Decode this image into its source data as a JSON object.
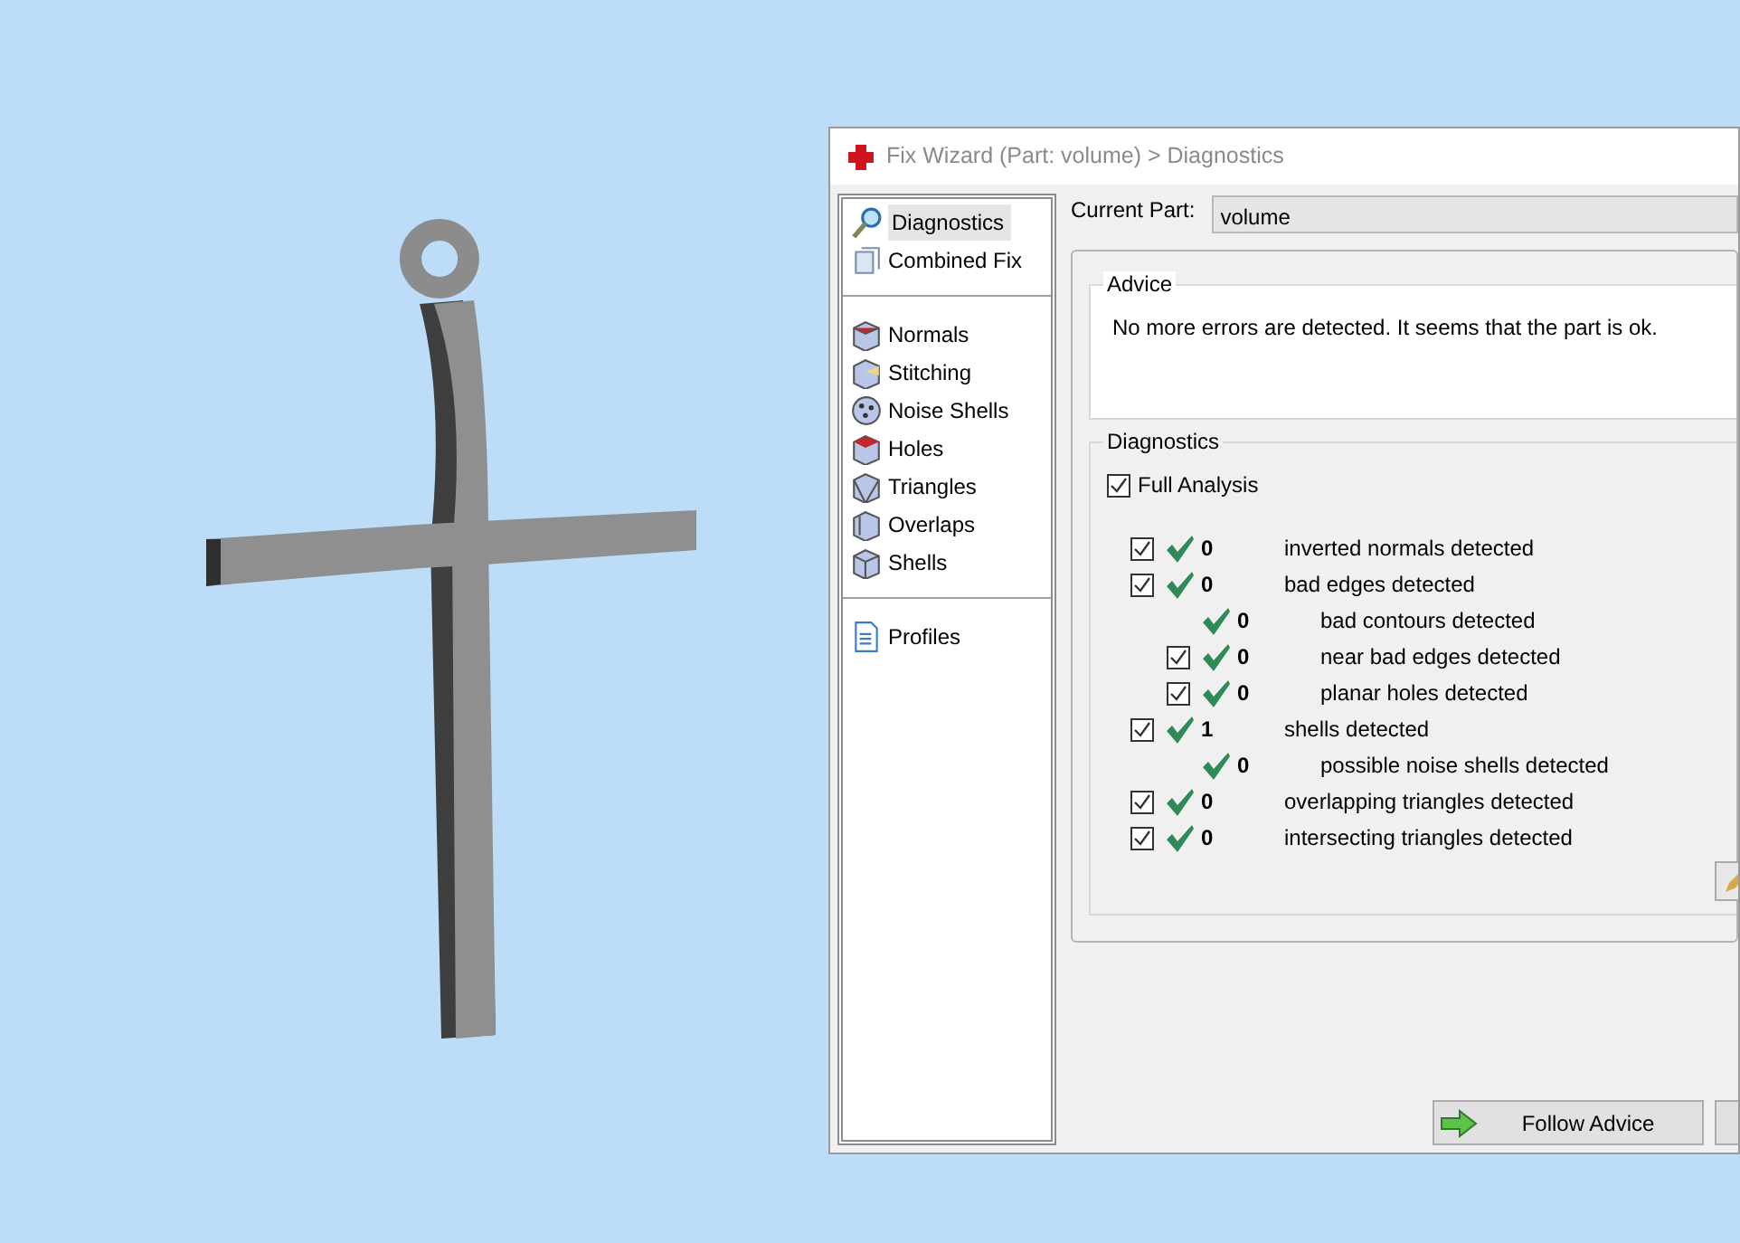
{
  "window": {
    "title": "Fix Wizard (Part: volume) > Diagnostics"
  },
  "sidebar": {
    "groups": [
      {
        "items": [
          {
            "label": "Diagnostics",
            "selected": true
          },
          {
            "label": "Combined Fix",
            "selected": false
          }
        ]
      },
      {
        "items": [
          {
            "label": "Normals",
            "selected": false
          },
          {
            "label": "Stitching",
            "selected": false
          },
          {
            "label": "Noise Shells",
            "selected": false
          },
          {
            "label": "Holes",
            "selected": false
          },
          {
            "label": "Triangles",
            "selected": false
          },
          {
            "label": "Overlaps",
            "selected": false
          },
          {
            "label": "Shells",
            "selected": false
          }
        ]
      },
      {
        "items": [
          {
            "label": "Profiles",
            "selected": false
          }
        ]
      }
    ]
  },
  "current_part": {
    "label": "Current Part:",
    "value": "volume"
  },
  "advice": {
    "title": "Advice",
    "text": "No more errors are detected. It seems that the part is ok."
  },
  "diagnostics": {
    "title": "Diagnostics",
    "full_analysis": {
      "label": "Full Analysis",
      "checked": true
    },
    "rows": [
      {
        "kind": "checkbox",
        "checked": true,
        "count": "0",
        "label": "inverted normals detected"
      },
      {
        "kind": "checkbox",
        "checked": true,
        "count": "0",
        "label": "bad edges detected",
        "children": [
          {
            "kind": "plain",
            "count": "0",
            "label": "bad contours detected"
          },
          {
            "kind": "checkbox",
            "checked": true,
            "count": "0",
            "label": "near bad edges detected"
          },
          {
            "kind": "checkbox",
            "checked": true,
            "count": "0",
            "label": "planar holes detected"
          }
        ]
      },
      {
        "kind": "checkbox",
        "checked": true,
        "count": "1",
        "label": "shells detected",
        "children": [
          {
            "kind": "plain",
            "count": "0",
            "label": "possible noise shells detected"
          }
        ]
      },
      {
        "kind": "checkbox",
        "checked": true,
        "count": "0",
        "label": "overlapping triangles detected"
      },
      {
        "kind": "checkbox",
        "checked": true,
        "count": "0",
        "label": "intersecting triangles detected"
      }
    ]
  },
  "buttons": [
    {
      "label": "Follow Advice"
    }
  ]
}
